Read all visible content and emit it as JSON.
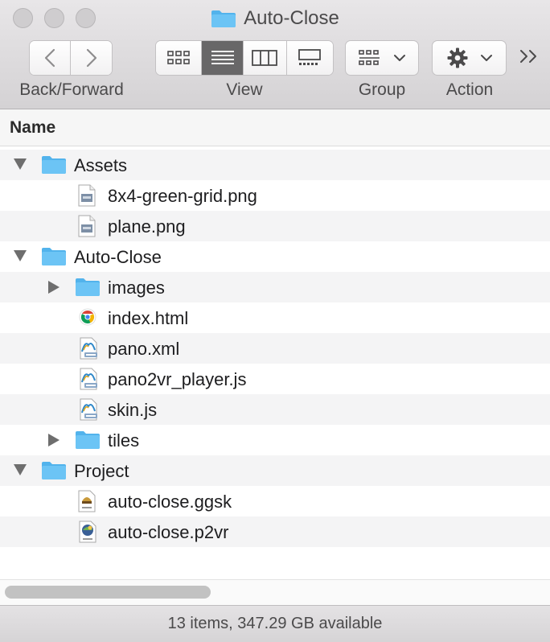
{
  "window": {
    "title": "Auto-Close"
  },
  "toolbar": {
    "nav_label": "Back/Forward",
    "view_label": "View",
    "group_label": "Group",
    "action_label": "Action",
    "view_modes": [
      "icon-view-icon",
      "list-view-icon",
      "column-view-icon",
      "gallery-view-icon"
    ],
    "active_view": "list-view-icon"
  },
  "header": {
    "name_column": "Name"
  },
  "files": [
    {
      "name": "Assets",
      "kind": "folder",
      "level": 0,
      "disclosure": "expanded"
    },
    {
      "name": "8x4-green-grid.png",
      "kind": "png",
      "level": 1
    },
    {
      "name": "plane.png",
      "kind": "png",
      "level": 1
    },
    {
      "name": "Auto-Close",
      "kind": "folder",
      "level": 0,
      "disclosure": "expanded"
    },
    {
      "name": "images",
      "kind": "folder",
      "level": 1,
      "disclosure": "collapsed"
    },
    {
      "name": "index.html",
      "kind": "html",
      "level": 1
    },
    {
      "name": "pano.xml",
      "kind": "text",
      "level": 1
    },
    {
      "name": "pano2vr_player.js",
      "kind": "text",
      "level": 1
    },
    {
      "name": "skin.js",
      "kind": "text",
      "level": 1
    },
    {
      "name": "tiles",
      "kind": "folder",
      "level": 1,
      "disclosure": "collapsed"
    },
    {
      "name": "Project",
      "kind": "folder",
      "level": 0,
      "disclosure": "expanded"
    },
    {
      "name": "auto-close.ggsk",
      "kind": "ggsk",
      "level": 1
    },
    {
      "name": "auto-close.p2vr",
      "kind": "p2vr",
      "level": 1
    }
  ],
  "status": {
    "text": "13 items, 347.29 GB available"
  },
  "colors": {
    "folder": "#6cc4f5",
    "folder_tab": "#52b3ec",
    "active_segment": "#686768"
  }
}
